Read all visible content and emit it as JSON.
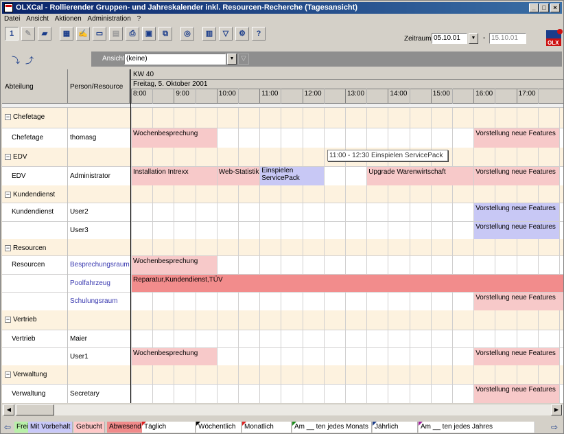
{
  "window": {
    "title": "OLXCal - Rollierender Gruppen- und Jahreskalender inkl. Resourcen-Recherche   (Tagesansicht)"
  },
  "menu": [
    "Datei",
    "Ansicht",
    "Aktionen",
    "Administration",
    "?"
  ],
  "toolbar": {
    "zeitraum_label": "Zeitraum:",
    "zeitraum_from": "05.10.01",
    "zeitraum_sep": "-",
    "zeitraum_to": "15.10.01",
    "logo_text": "OLX"
  },
  "view": {
    "label": "Ansicht:",
    "value": "(keine)"
  },
  "grid": {
    "col_abteilung": "Abteilung",
    "col_person": "Person/Resource",
    "week": "KW 40",
    "date": "Freitag, 5. Oktober 2001",
    "hours": [
      "8:00",
      "9:00",
      "10:00",
      "11:00",
      "12:00",
      "13:00",
      "14:00",
      "15:00",
      "16:00",
      "17:00"
    ],
    "groups": [
      {
        "name": "Chefetage"
      },
      {
        "name": "EDV"
      },
      {
        "name": "Kundendienst"
      },
      {
        "name": "Resourcen"
      },
      {
        "name": "Vertrieb"
      },
      {
        "name": "Verwaltung"
      }
    ],
    "rows": [
      {
        "abteilung": "Chefetage",
        "person": "thomasg"
      },
      {
        "abteilung": "EDV",
        "person": "Administrator"
      },
      {
        "abteilung": "Kundendienst",
        "person": "User2"
      },
      {
        "abteilung": "",
        "person": "User3"
      },
      {
        "abteilung": "Resourcen",
        "person": "Besprechungsraum"
      },
      {
        "abteilung": "",
        "person": "Poolfahrzeug"
      },
      {
        "abteilung": "",
        "person": "Schulungsraum"
      },
      {
        "abteilung": "Vertrieb",
        "person": "Maier"
      },
      {
        "abteilung": "",
        "person": "User1"
      },
      {
        "abteilung": "Verwaltung",
        "person": "Secretary"
      }
    ],
    "events": {
      "e1": "Wochenbesprechung",
      "e2": "Vorstellung neue Features",
      "e3": "Installation Intrexx",
      "e4": "Web-Statistik",
      "e5a": "Einspielen",
      "e5b": "ServicePack",
      "e6": "Upgrade Warenwirtschaft",
      "e7": "Vorstellung neue Features",
      "e8": "Vorstellung neue Features",
      "e9": "Vorstellung neue Features",
      "e10": "Wochenbesprechung",
      "e11": "Reparatur,Kundendienst,TÜV",
      "e12": "Vorstellung neue Features",
      "e13": "Wochenbesprechung",
      "e14": "Vorstellung neue Features",
      "e15": "Vorstellung neue Features"
    },
    "tooltip": "11:00 - 12:30 Einspielen ServicePack"
  },
  "legend": {
    "frei": "Frei",
    "vorbehalt": "Mit Vorbehalt",
    "gebucht": "Gebucht",
    "abwesend": "Abwesend",
    "taeglich": "Täglich",
    "woechentlich": "Wöchentlich",
    "monatlich": "Monatlich",
    "monat_tag": "Am __ ten jedes Monats",
    "jaehrlich": "Jährlich",
    "jahr_tag": "Am __ ten jedes Jahres"
  },
  "colors": {
    "titlebar": "#0a246a",
    "frei": "#b8f0a8",
    "vorbehalt": "#c8c8f8",
    "gebucht": "#ffc8c8",
    "abwesend": "#f08a8a",
    "group_row": "#fdf2df",
    "event_pink": "#f7c9c9",
    "event_blue": "#c8c8f5",
    "event_red": "#f28c8c"
  }
}
